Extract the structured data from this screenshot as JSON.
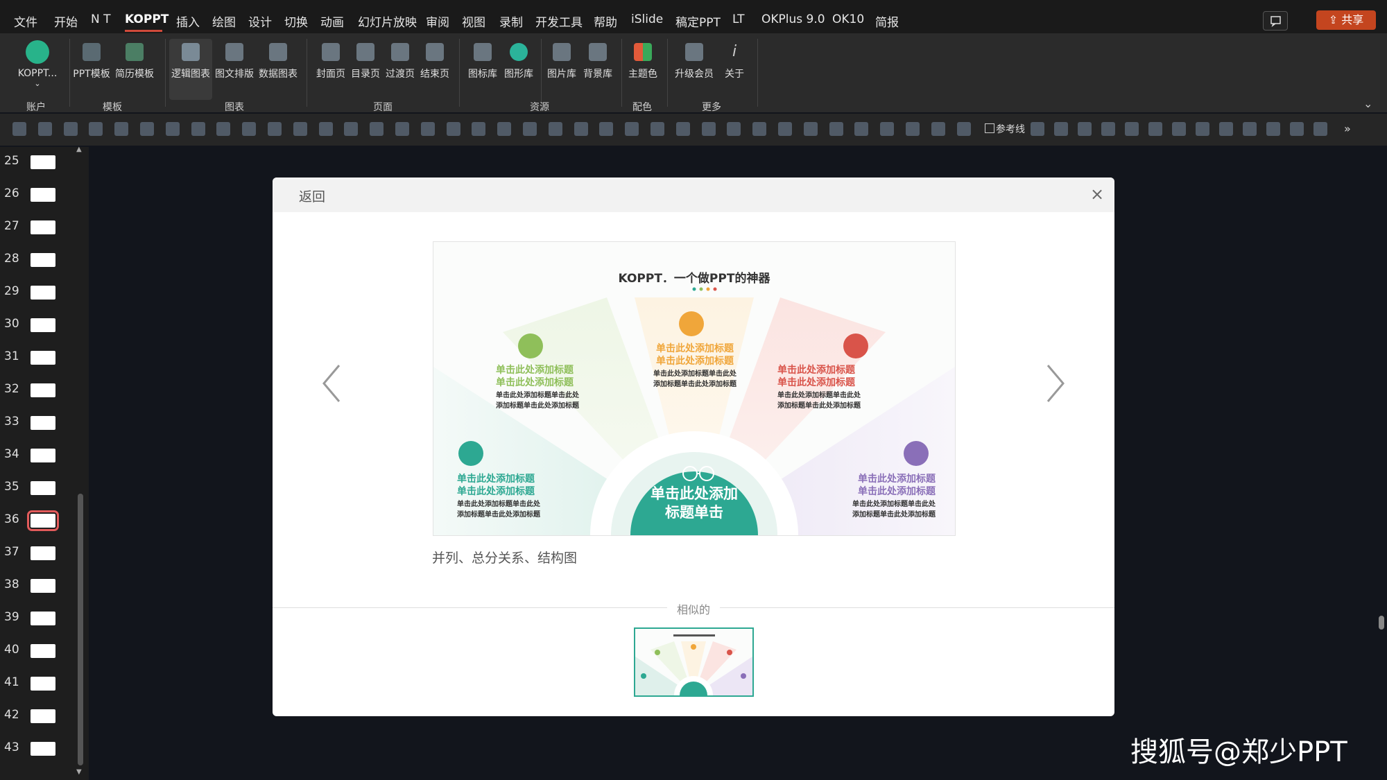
{
  "menubar": {
    "items": [
      "文件",
      "开始",
      "N T",
      "KOPPT",
      "插入",
      "绘图",
      "设计",
      "切换",
      "动画",
      "幻灯片放映",
      "审阅",
      "视图",
      "录制",
      "开发工具",
      "帮助",
      "iSlide",
      "稿定PPT",
      "LT",
      "OKPlus 9.0",
      "OK10",
      "简报"
    ],
    "active": "KOPPT",
    "share_label": "共享"
  },
  "ribbon": {
    "buttons": [
      "KOPPT...",
      "PPT模板",
      "简历模板",
      "逻辑图表",
      "图文排版",
      "数据图表",
      "封面页",
      "目录页",
      "过渡页",
      "结束页",
      "图标库",
      "图形库",
      "图片库",
      "背景库",
      "主题色",
      "升级会员",
      "关于"
    ],
    "groups": [
      "账户",
      "模板",
      "图表",
      "页面",
      "资源",
      "配色",
      "更多"
    ]
  },
  "toolbar2": {
    "reference_line_label": "参考线"
  },
  "slides": {
    "numbers": [
      "25",
      "26",
      "27",
      "28",
      "29",
      "30",
      "31",
      "32",
      "33",
      "34",
      "35",
      "36",
      "37",
      "38",
      "39",
      "40",
      "41",
      "42",
      "43"
    ],
    "selected": "36"
  },
  "dialog": {
    "back_label": "返回",
    "close_label": "×",
    "caption": "并列、总分关系、结构图",
    "similar_label": "相似的"
  },
  "preview": {
    "title": "KOPPT．一个做PPT的神器",
    "center_text_line1": "单击此处添加",
    "center_text_line2": "标题单击",
    "items": [
      {
        "title1": "单击此处添加标题",
        "title2": "单击此处添加标题",
        "desc1": "单击此处添加标题单击此处",
        "desc2": "添加标题单击此处添加标题"
      },
      {
        "title1": "单击此处添加标题",
        "title2": "单击此处添加标题",
        "desc1": "单击此处添加标题单击此处",
        "desc2": "添加标题单击此处添加标题"
      },
      {
        "title1": "单击此处添加标题",
        "title2": "单击此处添加标题",
        "desc1": "单击此处添加标题单击此处",
        "desc2": "添加标题单击此处添加标题"
      },
      {
        "title1": "单击此处添加标题",
        "title2": "单击此处添加标题",
        "desc1": "单击此处添加标题单击此处",
        "desc2": "添加标题单击此处添加标题"
      },
      {
        "title1": "单击此处添加标题",
        "title2": "单击此处添加标题",
        "desc1": "单击此处添加标题单击此处",
        "desc2": "添加标题单击此处添加标题"
      }
    ],
    "colors": {
      "teal": "#2da892",
      "green": "#8fbf5a",
      "orange": "#f0a63a",
      "red": "#d9544a",
      "purple": "#8a6fb8"
    }
  },
  "watermark": "搜狐号@郑少PPT"
}
